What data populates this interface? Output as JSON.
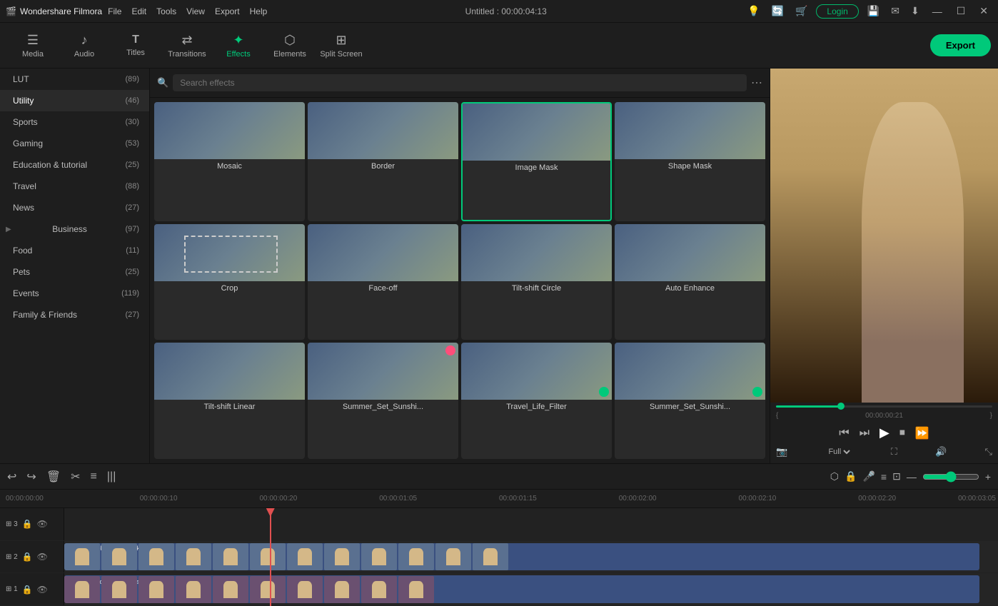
{
  "app": {
    "name": "Wondershare Filmora",
    "logo": "🎬",
    "title": "Untitled : 00:00:04:13"
  },
  "menus": [
    "File",
    "Edit",
    "Tools",
    "View",
    "Export",
    "Help"
  ],
  "titlebar_icons": [
    "💡",
    "🔄",
    "🛒"
  ],
  "login_label": "Login",
  "win_btns": [
    "—",
    "☐",
    "✕"
  ],
  "toolbar": {
    "items": [
      {
        "id": "media",
        "icon": "☰",
        "label": "Media"
      },
      {
        "id": "audio",
        "icon": "♪",
        "label": "Audio"
      },
      {
        "id": "titles",
        "icon": "T",
        "label": "Titles"
      },
      {
        "id": "transitions",
        "icon": "⇄",
        "label": "Transitions"
      },
      {
        "id": "effects",
        "icon": "✦",
        "label": "Effects",
        "active": true
      },
      {
        "id": "elements",
        "icon": "⬡",
        "label": "Elements"
      },
      {
        "id": "split-screen",
        "icon": "⊞",
        "label": "Split Screen"
      }
    ],
    "export_label": "Export"
  },
  "sidebar": {
    "items": [
      {
        "id": "lut",
        "label": "LUT",
        "count": 89
      },
      {
        "id": "utility",
        "label": "Utility",
        "count": 46,
        "active": true
      },
      {
        "id": "sports",
        "label": "Sports",
        "count": 30
      },
      {
        "id": "gaming",
        "label": "Gaming",
        "count": 53
      },
      {
        "id": "education",
        "label": "Education & tutorial",
        "count": 25
      },
      {
        "id": "travel",
        "label": "Travel",
        "count": 88
      },
      {
        "id": "news",
        "label": "News",
        "count": 27
      },
      {
        "id": "business",
        "label": "Business",
        "count": 97,
        "has_arrow": true
      },
      {
        "id": "food",
        "label": "Food",
        "count": 11
      },
      {
        "id": "pets",
        "label": "Pets",
        "count": 25
      },
      {
        "id": "events",
        "label": "Events",
        "count": 119
      },
      {
        "id": "family",
        "label": "Family & Friends",
        "count": 27
      }
    ]
  },
  "effects_search": {
    "placeholder": "Search effects"
  },
  "effects": {
    "items": [
      {
        "id": "mosaic",
        "name": "Mosaic",
        "thumb": "mosaic"
      },
      {
        "id": "border",
        "name": "Border",
        "thumb": "border"
      },
      {
        "id": "image-mask",
        "name": "Image Mask",
        "thumb": "imagemask",
        "selected": true
      },
      {
        "id": "shape-mask",
        "name": "Shape Mask",
        "thumb": "shapemask"
      },
      {
        "id": "crop",
        "name": "Crop",
        "thumb": "crop"
      },
      {
        "id": "face-off",
        "name": "Face-off",
        "thumb": "faceoff"
      },
      {
        "id": "tilt-shift-circle",
        "name": "Tilt-shift Circle",
        "thumb": "tiltshiftcircle"
      },
      {
        "id": "auto-enhance",
        "name": "Auto Enhance",
        "thumb": "autoenhance"
      },
      {
        "id": "tilt-shift-linear",
        "name": "Tilt-shift Linear",
        "thumb": "tiltshiftlinear"
      },
      {
        "id": "summer-set-sunshi1",
        "name": "Summer_Set_Sunshi...",
        "thumb": "summer",
        "badge": "pink"
      },
      {
        "id": "travel-life-filter",
        "name": "Travel_Life_Filter",
        "thumb": "travel",
        "badge": "green"
      },
      {
        "id": "summer-set-sunshi2",
        "name": "Summer_Set_Sunshi...",
        "thumb": "summerdown",
        "badge": "green"
      }
    ]
  },
  "preview": {
    "progress_percent": 30,
    "time_start": "{",
    "time_end": "}",
    "time_current": "00:00:00:21",
    "quality": "Full",
    "controls": {
      "rewind": "⏮",
      "step_back": "⏭",
      "play": "▶",
      "stop": "⏹",
      "step_fwd": "⏩"
    }
  },
  "timeline": {
    "toolbar_btns": [
      "↩",
      "↪",
      "🗑",
      "✂",
      "≡",
      "|||"
    ],
    "right_btns": [
      "⬡",
      "🔒",
      "🎤",
      "≡",
      "⊡",
      "—",
      "+"
    ],
    "ruler_marks": [
      "00:00:00:00",
      "00:00:00:10",
      "00:00:00:20",
      "00:00:01:05",
      "00:00:01:15",
      "00:00:02:00",
      "00:00:02:10",
      "00:00:02:20",
      "00:00:03:05"
    ],
    "tracks": [
      {
        "id": "track3",
        "num": 3,
        "locked": false,
        "visible": true
      },
      {
        "id": "track2",
        "num": 2,
        "locked": false,
        "visible": true,
        "clip_label": "pexels-karolina-grabowska-7976781"
      },
      {
        "id": "track1",
        "num": 1,
        "locked": false,
        "visible": true,
        "clip_label": "pexels-karolina-grabowska-7976781"
      }
    ]
  }
}
